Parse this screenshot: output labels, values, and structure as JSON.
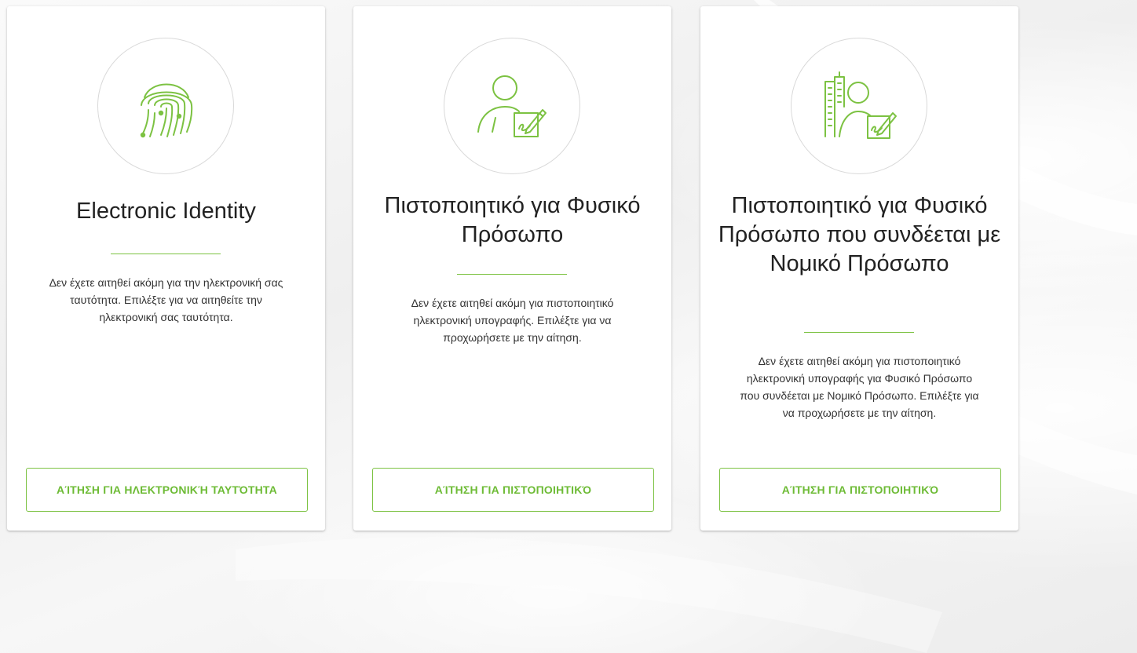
{
  "colors": {
    "accent": "#7cc242",
    "button_text": "#6dbb35",
    "title_text": "#222222",
    "body_text": "#333333",
    "card_background": "#ffffff",
    "icon_circle_border": "#d9d9d9"
  },
  "cards": [
    {
      "icon": "fingerprint-icon",
      "title": "Electronic Identity",
      "description": "Δεν έχετε αιτηθεί ακόμη για την ηλεκτρονική σας ταυτότητα. Επιλέξτε για να αιτηθείτε την ηλεκτρονική σας ταυτότητα.",
      "button_label": "ΑΊΤΗΣΗ ΓΙΑ ΗΛΕΚΤΡΟΝΙΚΉ ΤΑΥΤΌΤΗΤΑ"
    },
    {
      "icon": "person-signature-icon",
      "title": "Πιστοποιητικό για Φυσικό Πρόσωπο",
      "description": "Δεν έχετε αιτηθεί ακόμη για πιστοποιητικό ηλεκτρονική υπογραφής. Επιλέξτε για να προχωρήσετε με την αίτηση.",
      "button_label": "ΑΊΤΗΣΗ ΓΙΑ ΠΙΣΤΟΠΟΙΗΤΙΚΌ"
    },
    {
      "icon": "building-person-signature-icon",
      "title": "Πιστοποιητικό για Φυσικό Πρόσωπο που συνδέεται με Νομικό Πρόσωπο",
      "description": "Δεν έχετε αιτηθεί ακόμη για πιστοποιητικό ηλεκτρονική υπογραφής για Φυσικό Πρόσωπο που συνδέεται με Νομικό Πρόσωπο. Επιλέξτε για να προχωρήσετε με την αίτηση.",
      "button_label": "ΑΊΤΗΣΗ ΓΙΑ ΠΙΣΤΟΠΟΙΗΤΙΚΌ"
    }
  ]
}
